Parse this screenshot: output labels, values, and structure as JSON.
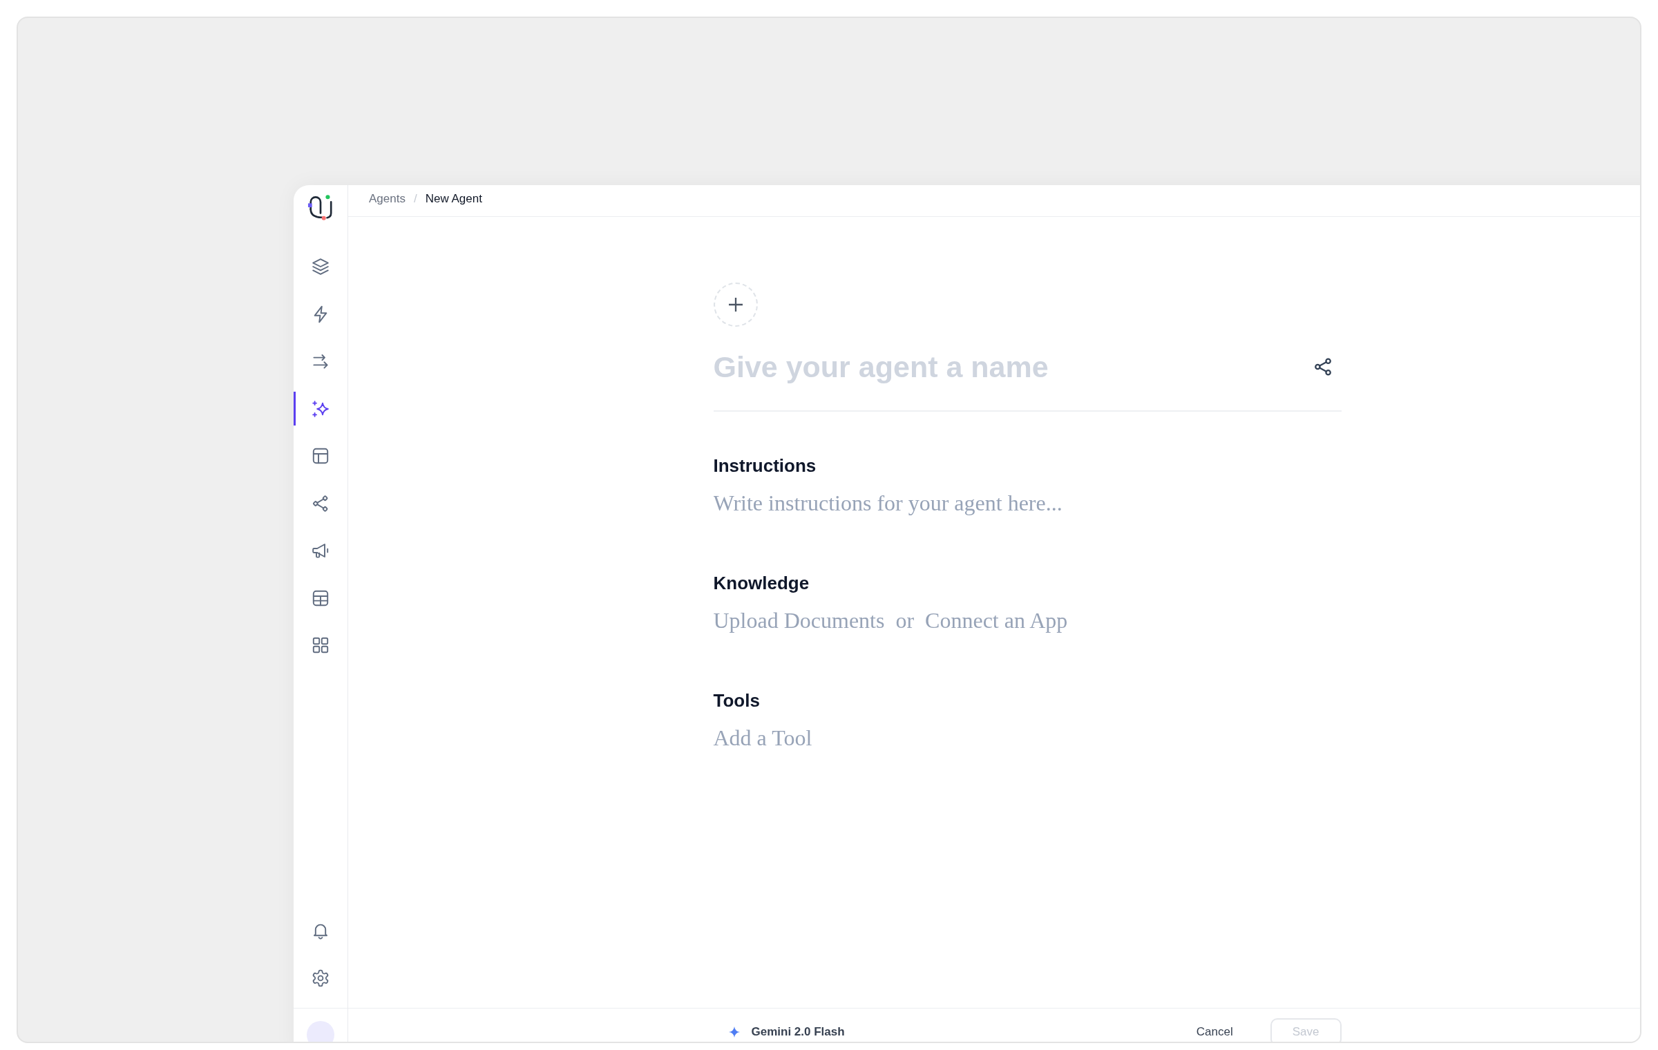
{
  "breadcrumb": {
    "separator": "/",
    "items": [
      {
        "label": "Agents",
        "current": false
      },
      {
        "label": "New Agent",
        "current": true
      }
    ]
  },
  "sidebar": {
    "nav_items": [
      {
        "selected": false
      },
      {
        "selected": false
      },
      {
        "selected": false
      },
      {
        "selected": true
      },
      {
        "selected": false
      },
      {
        "selected": false
      },
      {
        "selected": false
      },
      {
        "selected": false
      },
      {
        "selected": false
      }
    ]
  },
  "editor": {
    "name_field": {
      "placeholder": "Give your agent a name"
    },
    "sections": [
      {
        "title": "Instructions",
        "kind": "field",
        "placeholder": "Write instructions for your agent here..."
      },
      {
        "title": "Knowledge",
        "kind": "links",
        "links": [
          "Upload Documents",
          "Connect an App"
        ],
        "separator": "or"
      },
      {
        "title": "Tools",
        "kind": "links",
        "links": [
          "Add a Tool"
        ]
      }
    ]
  },
  "footer": {
    "model": {
      "label": "Gemini 2.0 Flash"
    },
    "buttons": [
      {
        "label": "Cancel",
        "kind": "plain",
        "disabled": false
      },
      {
        "label": "Save",
        "kind": "outlined",
        "disabled": true
      }
    ]
  }
}
